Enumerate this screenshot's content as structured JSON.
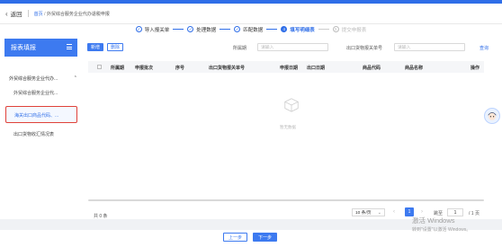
{
  "header": {
    "back_label": "返回",
    "breadcrumb": {
      "home": "首页",
      "separator": "/",
      "current": "外贸综合服务企业代办退税申报"
    }
  },
  "steps": [
    {
      "num": "",
      "label": "导入报关单",
      "state": "done"
    },
    {
      "num": "",
      "label": "处理数据",
      "state": "done"
    },
    {
      "num": "",
      "label": "匹配数据",
      "state": "done"
    },
    {
      "num": "4",
      "label": "填写明细表",
      "state": "active"
    },
    {
      "num": "5",
      "label": "提交申报表",
      "state": "todo"
    }
  ],
  "sidebar": {
    "title": "报表填报",
    "group_label": "外贸综合服务企业代办...",
    "items": [
      {
        "label": "外贸综合服务企业代..."
      },
      {
        "label": "海关出口商品代码、..."
      },
      {
        "label": "出口货物收汇情况表"
      }
    ]
  },
  "toolbar": {
    "add_label": "新增",
    "delete_label": "删除",
    "period_label": "所属期",
    "period_placeholder": "请输入",
    "decl_label": "出口货物报关单号",
    "decl_placeholder": "请输入",
    "query_label": "查询"
  },
  "table": {
    "columns": [
      "所属期",
      "申报批次",
      "序号",
      "出口货物报关单号",
      "申报日期",
      "出口日期",
      "商品代码",
      "商品名称",
      "操作"
    ],
    "empty_text": "暂无数据"
  },
  "pagination": {
    "total_label": "共 0 条",
    "page_size": "10 条/页",
    "current_page": "1",
    "goto_label": "跳至",
    "goto_value": "1",
    "total_pages": "/ 1 页"
  },
  "footer": {
    "prev_label": "上一步",
    "next_label": "下一步"
  },
  "watermark": {
    "line1": "激活 Windows",
    "line2": "转到\"设置\"以激活 Windows。"
  },
  "colors": {
    "primary": "#3d7af0",
    "highlight_border": "#e0413a"
  }
}
